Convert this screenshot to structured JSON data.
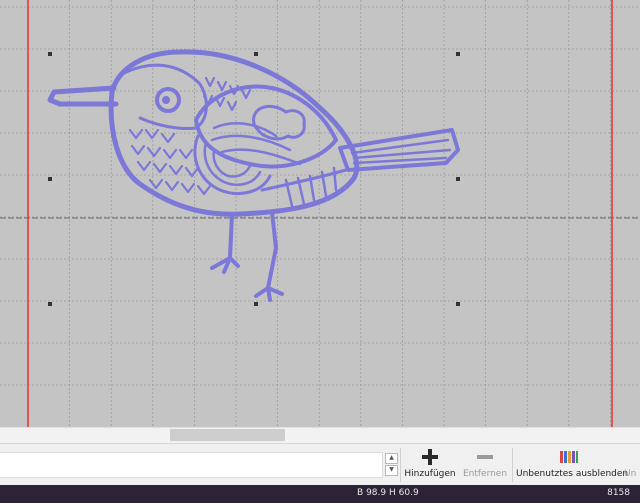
{
  "colors": {
    "canvas_bg": "#c4c4c4",
    "grid_line": "#9a9a9a",
    "hoop_edge": "#e8302c",
    "thread": "#7b78d8",
    "thread_shadow": "#5450b0",
    "statusbar_bg": "#2c2436"
  },
  "canvas": {
    "design_name": "bird embroidery design"
  },
  "toolbar": {
    "add_label": "Hinzufügen",
    "add_icon": "plus-icon",
    "remove_label": "Entfernen",
    "remove_icon": "minus-icon",
    "remove_enabled": false,
    "hide_unused_label": "Unbenutztes ausblenden",
    "hide_unused_icon": "thread-spools-icon",
    "next_label_partial": "Un"
  },
  "status": {
    "width_label": "B",
    "width_value": "98.9",
    "height_label": "H",
    "height_value": "60.9",
    "stitch_count": "8158"
  }
}
